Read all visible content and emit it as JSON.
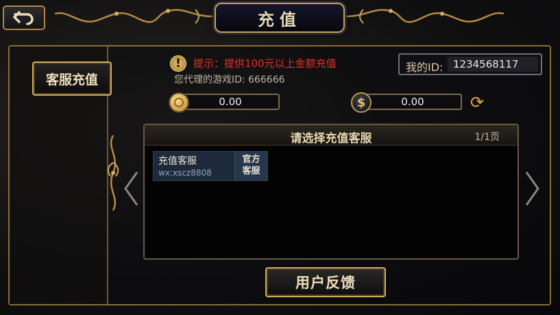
{
  "header": {
    "title": "充值",
    "back_icon": "back-arrow-icon"
  },
  "sidebar": {
    "tab_label": "客服充值"
  },
  "notice": {
    "icon": "warning-icon",
    "text": "提示：提供100元以上金额充值"
  },
  "agent": {
    "text": "您代理的游戏ID: 666666"
  },
  "my_id": {
    "label": "我的ID:",
    "value": "1234568117"
  },
  "balances": {
    "gold_value": "0.00",
    "gold_icon": "gold-coin-icon",
    "cash_value": "0.00",
    "cash_icon": "dollar-coin-icon",
    "refresh_icon": "refresh-icon"
  },
  "service_panel": {
    "title": "请选择充值客服",
    "page": "1/1页",
    "items": [
      {
        "name": "充值客服",
        "contact": "wx:xscz8808",
        "tag_line1": "官方",
        "tag_line2": "客服"
      }
    ]
  },
  "footer": {
    "feedback_label": "用户反馈"
  },
  "colors": {
    "gold_accent": "#c9a258",
    "notice_red": "#e0312a",
    "card_blue": "#1e2a3a"
  }
}
